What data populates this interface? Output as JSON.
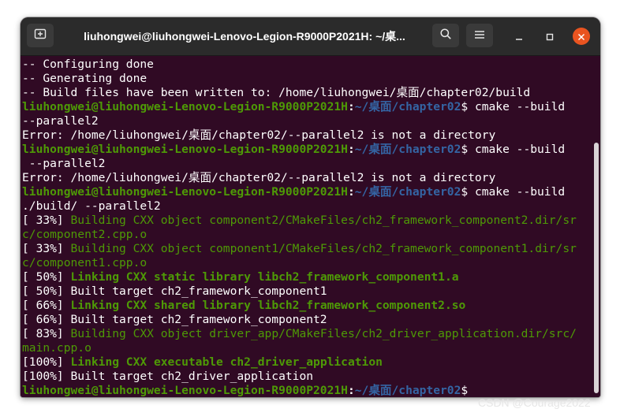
{
  "window": {
    "title": "liuhongwei@liuhongwei-Lenovo-Legion-R9000P2021H: ~/桌..."
  },
  "icons": {
    "new_tab": "new-tab-icon",
    "search": "search-icon",
    "menu": "hamburger-menu-icon",
    "minimize": "minimize-icon",
    "maximize": "maximize-icon",
    "close": "close-icon"
  },
  "colors": {
    "terminal_bg": "#300a24",
    "prompt_user": "#4e9a06",
    "prompt_path": "#3465a4",
    "close_button": "#e95420",
    "titlebar": "#2b2b2b"
  },
  "terminal": {
    "lines": [
      [
        {
          "t": "-- Configuring done",
          "c": "plain"
        }
      ],
      [
        {
          "t": "-- Generating done",
          "c": "plain"
        }
      ],
      [
        {
          "t": "-- Build files have been written to: /home/liuhongwei/桌面/chapter02/build",
          "c": "plain"
        }
      ],
      [
        {
          "t": "liuhongwei@liuhongwei-Lenovo-Legion-R9000P2021H",
          "c": "green-bold"
        },
        {
          "t": ":",
          "c": "white-bold"
        },
        {
          "t": "~/桌面/chapter02",
          "c": "blue-bold"
        },
        {
          "t": "$ cmake --build",
          "c": "plain"
        }
      ],
      [
        {
          "t": "--parallel2",
          "c": "plain"
        }
      ],
      [
        {
          "t": "Error: /home/liuhongwei/桌面/chapter02/--parallel2 is not a directory",
          "c": "plain"
        }
      ],
      [
        {
          "t": "liuhongwei@liuhongwei-Lenovo-Legion-R9000P2021H",
          "c": "green-bold"
        },
        {
          "t": ":",
          "c": "white-bold"
        },
        {
          "t": "~/桌面/chapter02",
          "c": "blue-bold"
        },
        {
          "t": "$ cmake --build",
          "c": "plain"
        }
      ],
      [
        {
          "t": " --parallel2",
          "c": "plain"
        }
      ],
      [
        {
          "t": "Error: /home/liuhongwei/桌面/chapter02/--parallel2 is not a directory",
          "c": "plain"
        }
      ],
      [
        {
          "t": "liuhongwei@liuhongwei-Lenovo-Legion-R9000P2021H",
          "c": "green-bold"
        },
        {
          "t": ":",
          "c": "white-bold"
        },
        {
          "t": "~/桌面/chapter02",
          "c": "blue-bold"
        },
        {
          "t": "$ cmake --build",
          "c": "plain"
        }
      ],
      [
        {
          "t": "./build/ --parallel2",
          "c": "plain"
        }
      ],
      [
        {
          "t": "[ 33%] ",
          "c": "plain"
        },
        {
          "t": "Building CXX object component2/CMakeFiles/ch2_framework_component2.dir/sr",
          "c": "green"
        }
      ],
      [
        {
          "t": "c/component2.cpp.o",
          "c": "green"
        }
      ],
      [
        {
          "t": "[ 33%] ",
          "c": "plain"
        },
        {
          "t": "Building CXX object component1/CMakeFiles/ch2_framework_component1.dir/sr",
          "c": "green"
        }
      ],
      [
        {
          "t": "c/component1.cpp.o",
          "c": "green"
        }
      ],
      [
        {
          "t": "[ 50%] ",
          "c": "plain"
        },
        {
          "t": "Linking CXX static library libch2_framework_component1.a",
          "c": "green-bold"
        }
      ],
      [
        {
          "t": "[ 50%] Built target ch2_framework_component1",
          "c": "plain"
        }
      ],
      [
        {
          "t": "[ 66%] ",
          "c": "plain"
        },
        {
          "t": "Linking CXX shared library libch2_framework_component2.so",
          "c": "green-bold"
        }
      ],
      [
        {
          "t": "[ 66%] Built target ch2_framework_component2",
          "c": "plain"
        }
      ],
      [
        {
          "t": "[ 83%] ",
          "c": "plain"
        },
        {
          "t": "Building CXX object driver_app/CMakeFiles/ch2_driver_application.dir/src/",
          "c": "green"
        }
      ],
      [
        {
          "t": "main.cpp.o",
          "c": "green"
        }
      ],
      [
        {
          "t": "[100%] ",
          "c": "plain"
        },
        {
          "t": "Linking CXX executable ch2_driver_application",
          "c": "green-bold"
        }
      ],
      [
        {
          "t": "[100%] Built target ch2_driver_application",
          "c": "plain"
        }
      ],
      [
        {
          "t": "liuhongwei@liuhongwei-Lenovo-Legion-R9000P2021H",
          "c": "green-bold"
        },
        {
          "t": ":",
          "c": "white-bold"
        },
        {
          "t": "~/桌面/chapter02",
          "c": "blue-bold"
        },
        {
          "t": "$ ",
          "c": "plain"
        }
      ]
    ]
  },
  "watermark": "CSDN @Courage2022"
}
